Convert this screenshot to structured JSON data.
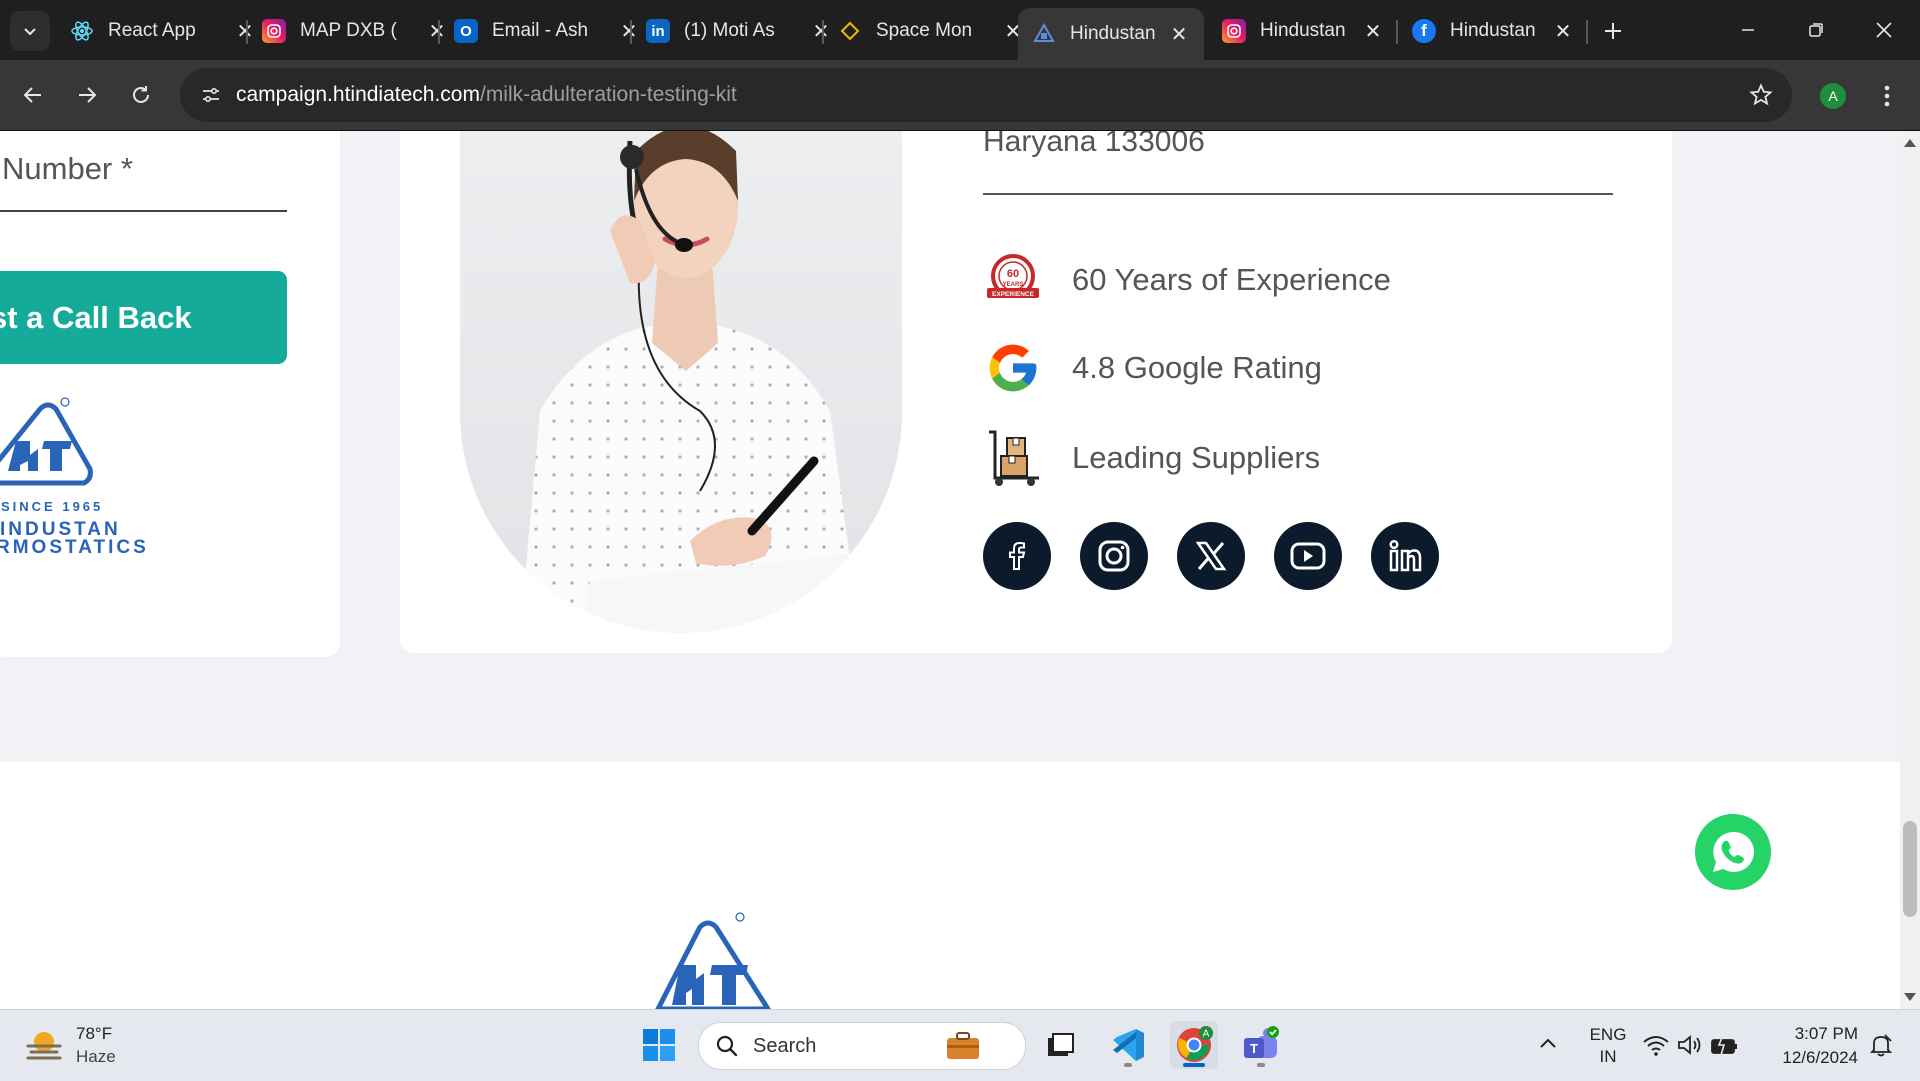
{
  "browser": {
    "tabs": [
      {
        "label": "React App",
        "icon": "react-icon",
        "active": false
      },
      {
        "label": "MAP DXB (",
        "icon": "instagram-icon",
        "active": false
      },
      {
        "label": "Email - Ash",
        "icon": "outlook-icon",
        "active": false
      },
      {
        "label": "(1) Moti As",
        "icon": "linkedin-icon",
        "active": false
      },
      {
        "label": "Space Mon",
        "icon": "space-icon",
        "active": false
      },
      {
        "label": "Hindustan",
        "icon": "ht-icon",
        "active": true
      },
      {
        "label": "Hindustan",
        "icon": "instagram-icon",
        "active": false
      },
      {
        "label": "Hindustan",
        "icon": "facebook-icon",
        "active": false
      }
    ],
    "url_host": "campaign.htindiatech.com",
    "url_path": "/milk-adulteration-testing-kit",
    "profile_initial": "A"
  },
  "page": {
    "form": {
      "number_label": "Number *",
      "callback_button": "st a Call Back"
    },
    "left_logo": {
      "since": "SINCE 1965",
      "name_line1": "INDUSTAN",
      "name_line2": "RMOSTATICS"
    },
    "contact": {
      "address_line": "Haryana 133006",
      "features": [
        {
          "icon": "60-years-experience-badge-icon",
          "text": "60 Years of Experience"
        },
        {
          "icon": "google-icon",
          "text": "4.8 Google Rating"
        },
        {
          "icon": "supplier-trolley-icon",
          "text": "Leading Suppliers"
        }
      ],
      "experience_badge_text": [
        "60",
        "YEARS",
        "EXPERIENCE"
      ],
      "social": [
        "facebook",
        "instagram",
        "x",
        "youtube",
        "linkedin"
      ]
    }
  },
  "taskbar": {
    "weather_temp": "78°F",
    "weather_cond": "Haze",
    "search_placeholder": "Search",
    "lang_line1": "ENG",
    "lang_line2": "IN",
    "time": "3:07 PM",
    "date": "12/6/2024"
  },
  "colors": {
    "callback_button": "#15aa9a",
    "brand_blue": "#2a64b8",
    "social_bg": "#0b1b2b",
    "whatsapp": "#25d366"
  }
}
